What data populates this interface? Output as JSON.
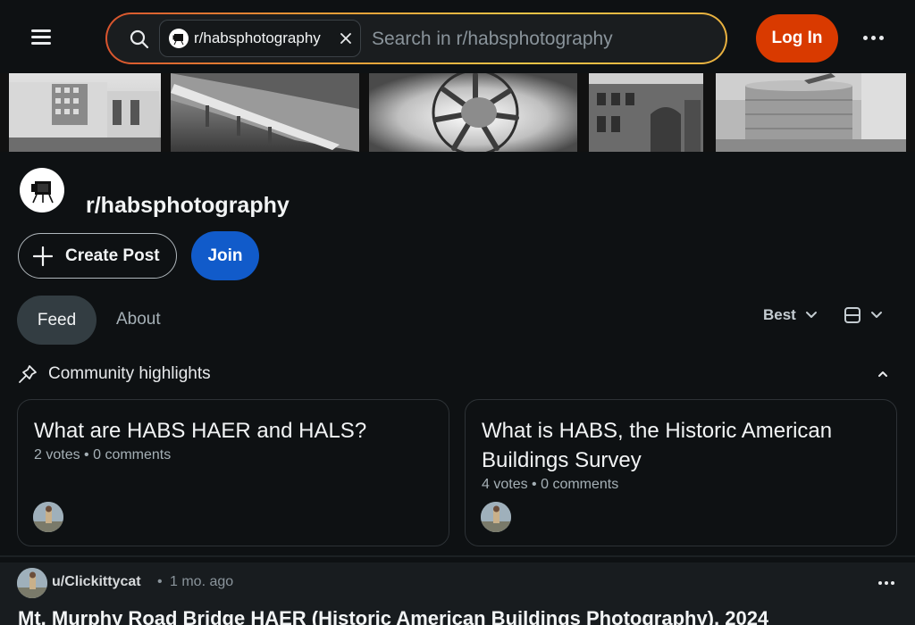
{
  "header": {
    "search_chip_label": "r/habsphotography",
    "search_placeholder": "Search in r/habsphotography",
    "login_label": "Log In",
    "icons": [
      "menu-icon",
      "search-icon",
      "close-icon",
      "more-icon"
    ]
  },
  "community": {
    "name": "r/habsphotography",
    "create_post_label": "Create Post",
    "join_label": "Join"
  },
  "tabs": [
    {
      "label": "Feed",
      "selected": true
    },
    {
      "label": "About",
      "selected": false
    }
  ],
  "sort": {
    "label": "Best"
  },
  "highlights": {
    "header": "Community highlights",
    "cards": [
      {
        "title": "What are HABS HAER and HALS?",
        "votes": "2 votes",
        "comments": "0 comments"
      },
      {
        "title": "What is HABS, the Historic American Buildings Survey",
        "votes": "4 votes",
        "comments": "0 comments"
      }
    ]
  },
  "post": {
    "user": "u/Clickittycat",
    "separator": "•",
    "time": "1 mo. ago",
    "title": "Mt. Murphy Road Bridge HAER (Historic American Buildings Photography), 2024"
  },
  "colors": {
    "background": "#0e1113",
    "login": "#d93a00",
    "join": "#115bca",
    "feed_tab": "#333d42"
  }
}
